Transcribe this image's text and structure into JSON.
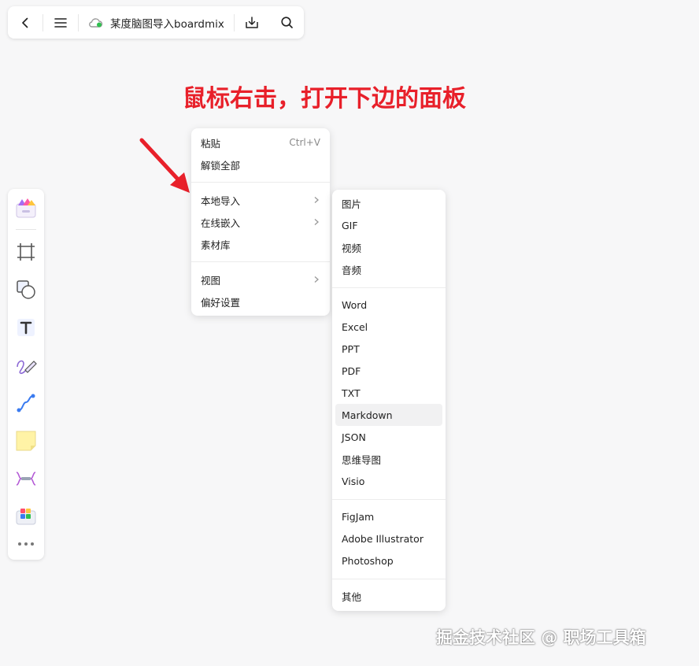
{
  "topbar": {
    "back_icon": "chevron-left-icon",
    "menu_icon": "hamburger-menu-icon",
    "cloud_icon": "cloud-sync-icon",
    "title": "某度脑图导入boardmix",
    "download_icon": "download-icon",
    "search_icon": "search-icon"
  },
  "annotation": {
    "text": "鼠标右击，打开下边的面板",
    "color": "#e8202a"
  },
  "left_toolbar": {
    "items": [
      "template-icon",
      "frame-icon",
      "shape-icon",
      "text-icon",
      "pen-icon",
      "connector-icon",
      "sticky-note-icon",
      "mindmap-icon",
      "widget-icon",
      "more-icon"
    ]
  },
  "context_menu": {
    "items": [
      {
        "label": "粘贴",
        "shortcut": "Ctrl+V"
      },
      {
        "label": "解锁全部"
      },
      {
        "label": "本地导入"
      },
      {
        "label": "在线嵌入"
      },
      {
        "label": "素材库"
      },
      {
        "label": "视图"
      },
      {
        "label": "偏好设置"
      }
    ]
  },
  "submenu": {
    "items": [
      {
        "label": "图片"
      },
      {
        "label": "GIF"
      },
      {
        "label": "视频"
      },
      {
        "label": "音频"
      },
      {
        "label": "Word"
      },
      {
        "label": "Excel"
      },
      {
        "label": "PPT"
      },
      {
        "label": "PDF"
      },
      {
        "label": "TXT"
      },
      {
        "label": "Markdown",
        "highlighted": true
      },
      {
        "label": "JSON"
      },
      {
        "label": "思维导图"
      },
      {
        "label": "Visio"
      },
      {
        "label": "FigJam"
      },
      {
        "label": "Adobe Illustrator"
      },
      {
        "label": "Photoshop"
      },
      {
        "label": "其他"
      }
    ]
  },
  "watermark": "掘金技术社区 @ 职场工具箱"
}
